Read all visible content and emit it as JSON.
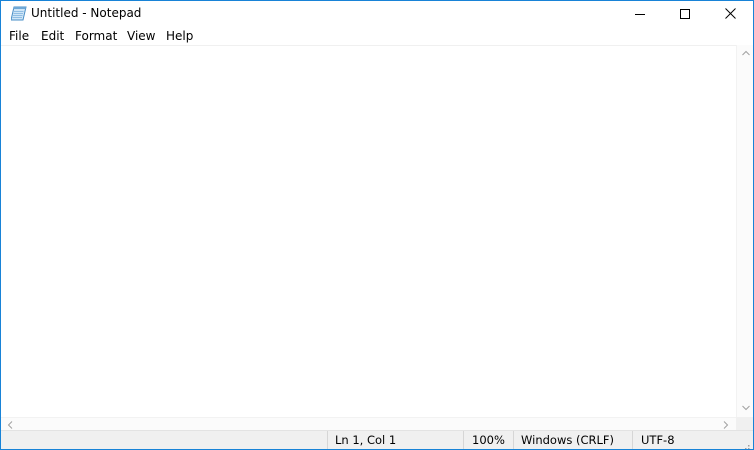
{
  "window": {
    "title": "Untitled - Notepad",
    "app_icon": "notepad-icon",
    "controls": {
      "minimize": "minimize-icon",
      "maximize": "maximize-icon",
      "close": "close-icon"
    }
  },
  "menu": {
    "items": [
      {
        "label": "File"
      },
      {
        "label": "Edit"
      },
      {
        "label": "Format"
      },
      {
        "label": "View"
      },
      {
        "label": "Help"
      }
    ]
  },
  "editor": {
    "content": ""
  },
  "status": {
    "position": "Ln 1, Col 1",
    "zoom": "100%",
    "line_ending": "Windows (CRLF)",
    "encoding": "UTF-8"
  },
  "colors": {
    "border": "#1883d7",
    "statusbar_bg": "#f0f0f0"
  }
}
